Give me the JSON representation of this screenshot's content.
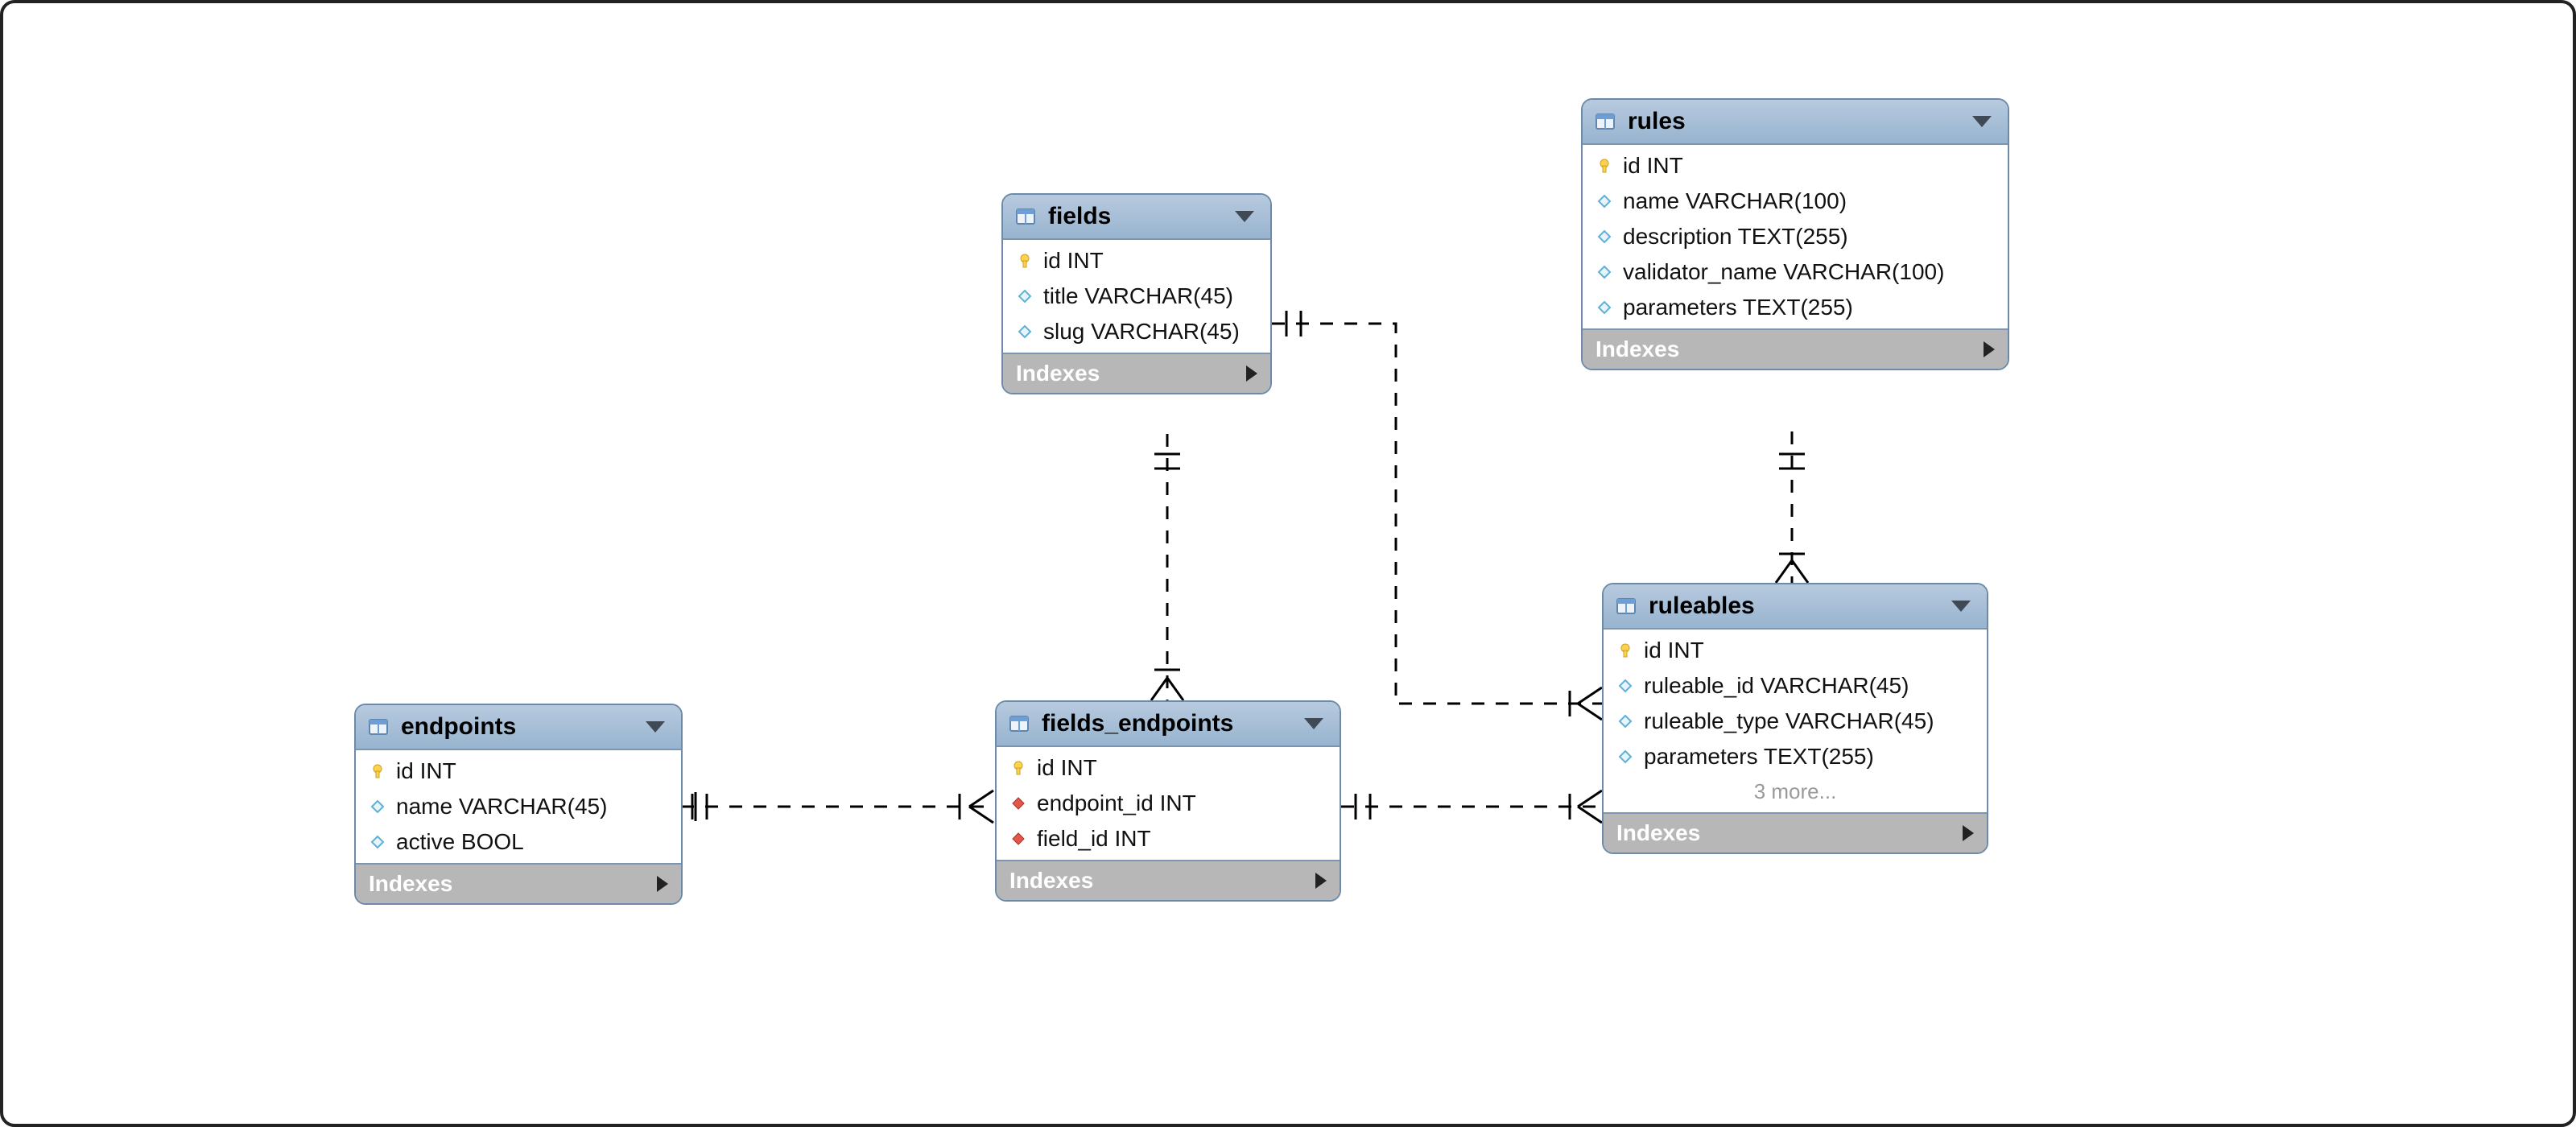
{
  "indexes_label": "Indexes",
  "tables": {
    "endpoints": {
      "title": "endpoints",
      "columns": [
        {
          "icon": "key",
          "name": "id INT"
        },
        {
          "icon": "diamond",
          "name": "name VARCHAR(45)"
        },
        {
          "icon": "diamond",
          "name": "active BOOL"
        }
      ]
    },
    "fields": {
      "title": "fields",
      "columns": [
        {
          "icon": "key",
          "name": "id INT"
        },
        {
          "icon": "diamond",
          "name": "title VARCHAR(45)"
        },
        {
          "icon": "diamond",
          "name": "slug VARCHAR(45)"
        }
      ]
    },
    "fields_endpoints": {
      "title": "fields_endpoints",
      "columns": [
        {
          "icon": "key",
          "name": "id INT"
        },
        {
          "icon": "fk",
          "name": "endpoint_id INT"
        },
        {
          "icon": "fk",
          "name": "field_id INT"
        }
      ]
    },
    "rules": {
      "title": "rules",
      "columns": [
        {
          "icon": "key",
          "name": "id INT"
        },
        {
          "icon": "diamond",
          "name": "name VARCHAR(100)"
        },
        {
          "icon": "diamond",
          "name": "description TEXT(255)"
        },
        {
          "icon": "diamond",
          "name": "validator_name VARCHAR(100)"
        },
        {
          "icon": "diamond",
          "name": "parameters TEXT(255)"
        }
      ]
    },
    "ruleables": {
      "title": "ruleables",
      "columns": [
        {
          "icon": "key",
          "name": "id INT"
        },
        {
          "icon": "diamond",
          "name": "ruleable_id VARCHAR(45)"
        },
        {
          "icon": "diamond",
          "name": "ruleable_type VARCHAR(45)"
        },
        {
          "icon": "diamond",
          "name": "parameters TEXT(255)"
        }
      ],
      "more": "3 more..."
    }
  },
  "relations": [
    {
      "from": "endpoints",
      "to": "fields_endpoints",
      "cardinality": "1-to-many"
    },
    {
      "from": "fields",
      "to": "fields_endpoints",
      "cardinality": "1-to-many"
    },
    {
      "from": "fields_endpoints",
      "to": "ruleables",
      "cardinality": "1-to-many"
    },
    {
      "from": "fields",
      "to": "ruleables",
      "cardinality": "1-to-many"
    },
    {
      "from": "rules",
      "to": "ruleables",
      "cardinality": "1-to-many"
    }
  ]
}
